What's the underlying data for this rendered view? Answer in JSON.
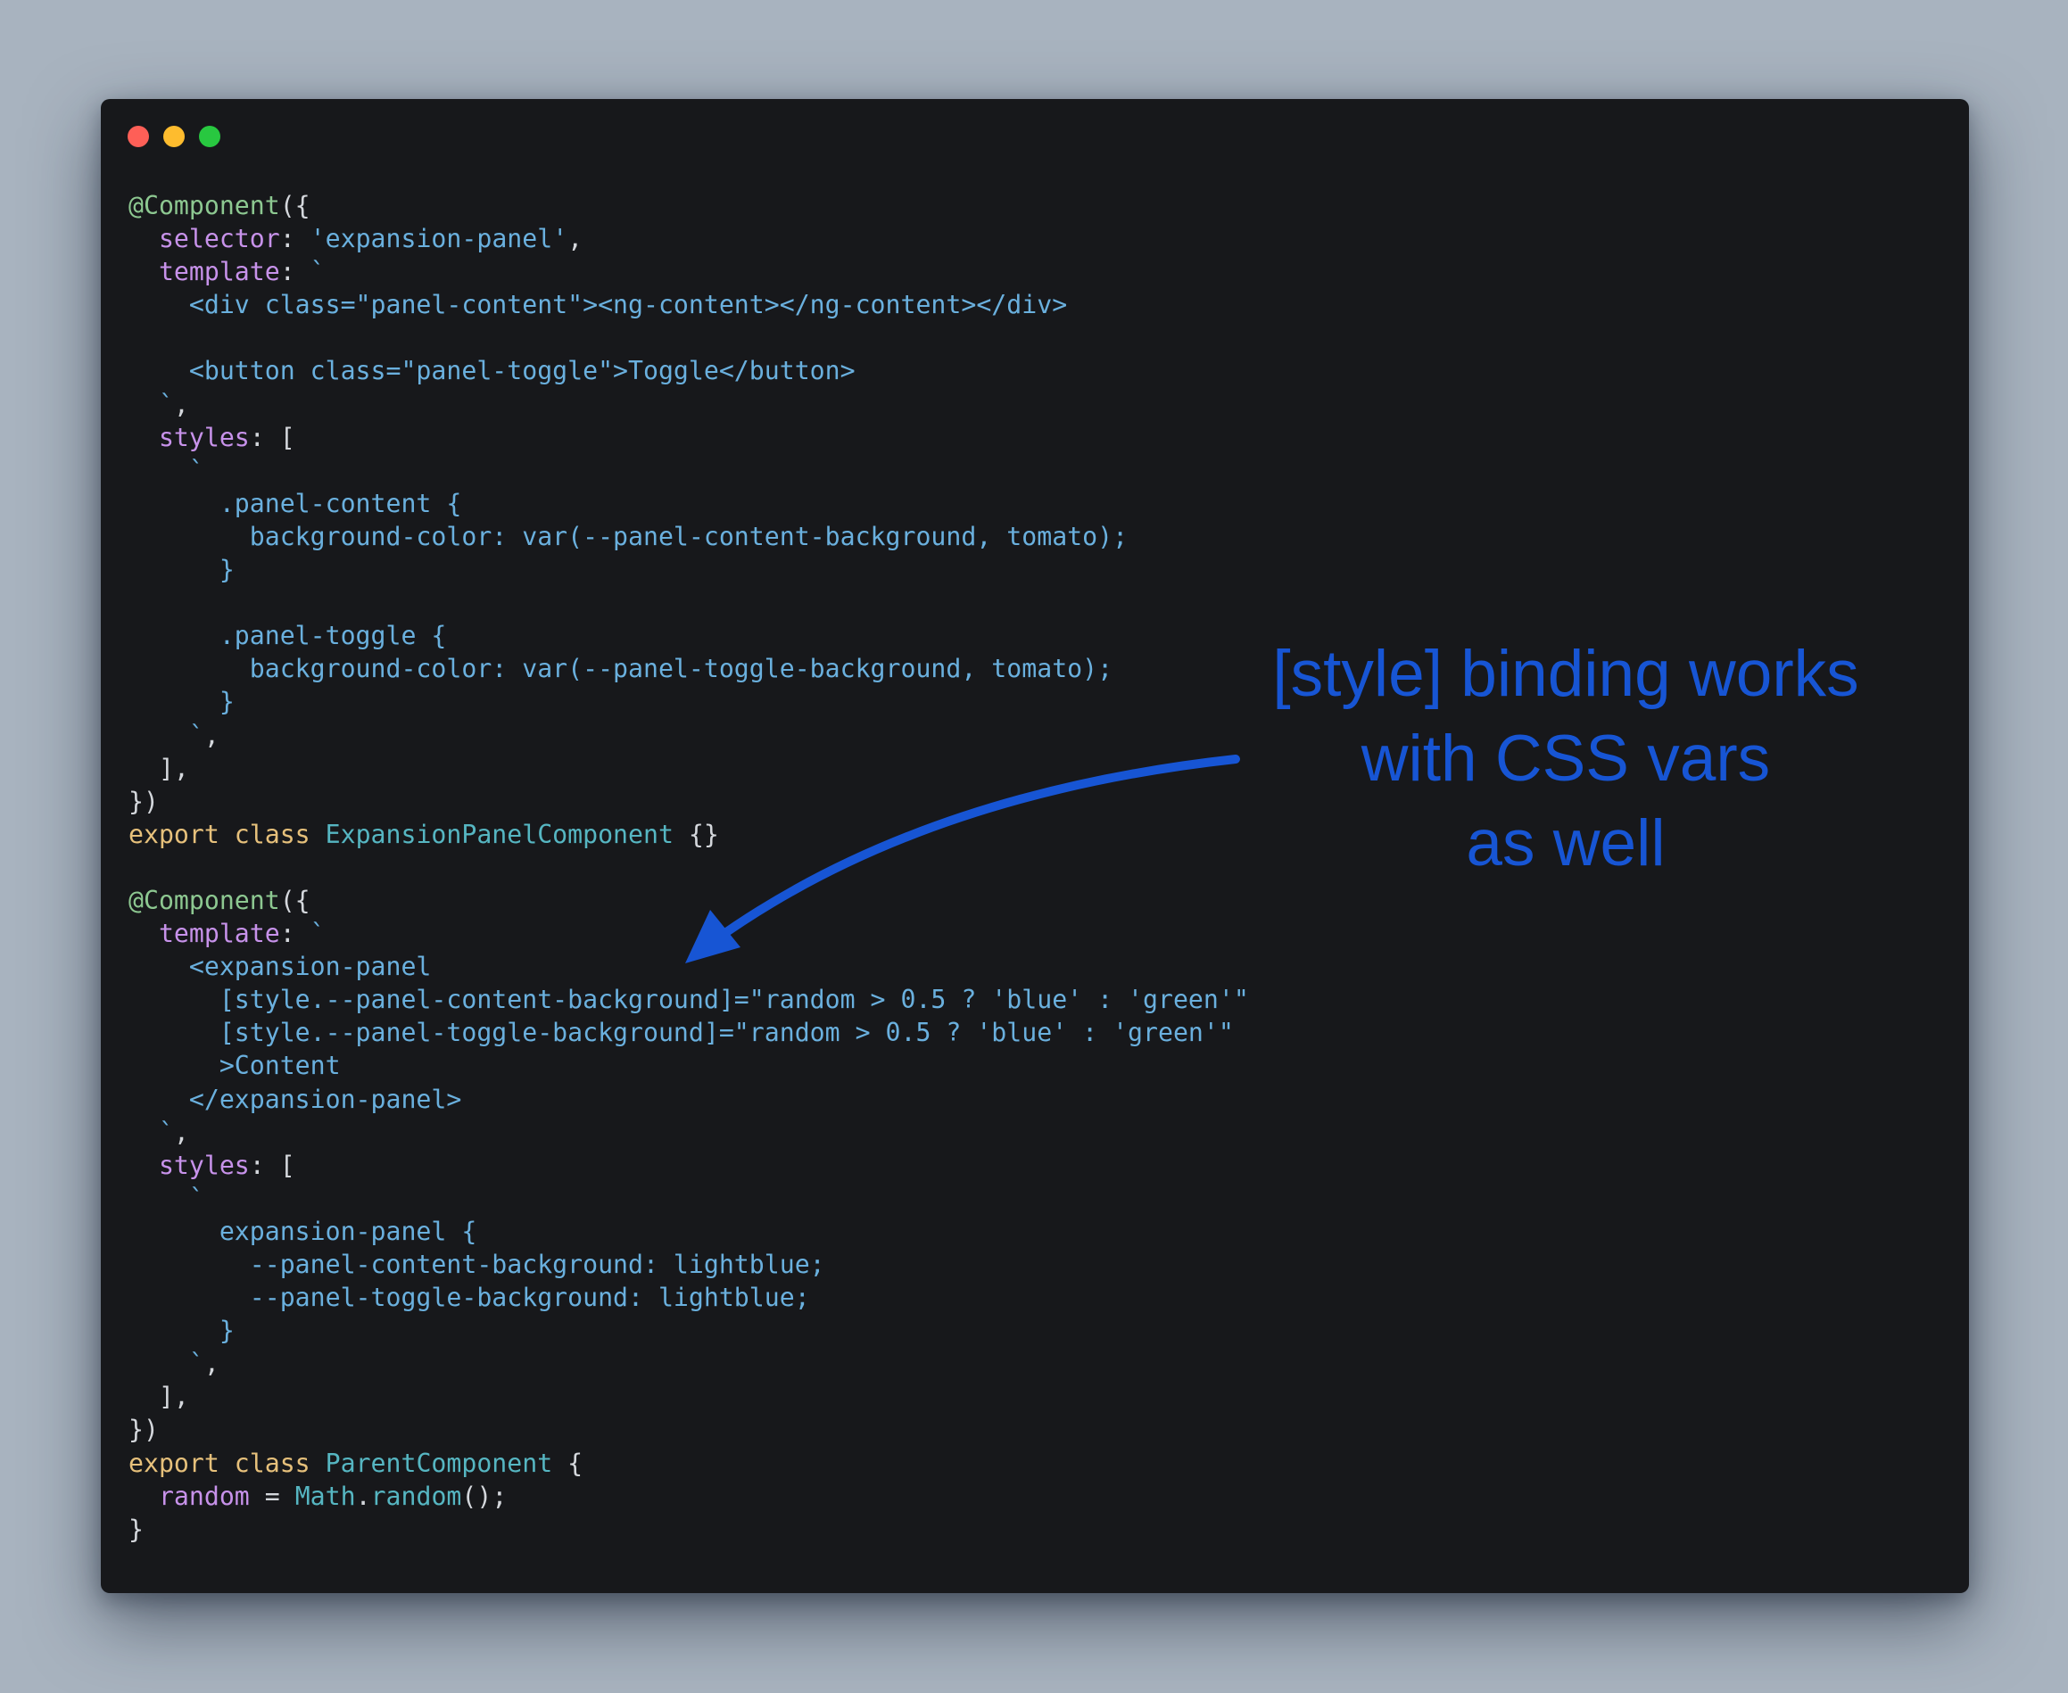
{
  "window": {
    "controls": {
      "close_color": "#fe5f57",
      "minimize_color": "#febc2e",
      "maximize_color": "#28c840"
    }
  },
  "colors": {
    "decorator": "#8dc891",
    "property": "#c792ea",
    "string": "#6ab0de",
    "keyword": "#e6c07b",
    "class_name": "#56b6c2",
    "plain": "#d4d7dc",
    "annotation": "#1755d4"
  },
  "code": {
    "lines": [
      [
        [
          "dec",
          "@Component"
        ],
        [
          "plain",
          "({"
        ]
      ],
      [
        [
          "plain",
          "  "
        ],
        [
          "prop",
          "selector"
        ],
        [
          "plain",
          ": "
        ],
        [
          "str",
          "'expansion-panel'"
        ],
        [
          "plain",
          ","
        ]
      ],
      [
        [
          "plain",
          "  "
        ],
        [
          "prop",
          "template"
        ],
        [
          "plain",
          ": "
        ],
        [
          "str",
          "`"
        ]
      ],
      [
        [
          "str",
          "    <div class=\"panel-content\"><ng-content></ng-content></div>"
        ]
      ],
      [
        [
          "str",
          ""
        ]
      ],
      [
        [
          "str",
          "    <button class=\"panel-toggle\">Toggle</button>"
        ]
      ],
      [
        [
          "str",
          "  `"
        ],
        [
          "plain",
          ","
        ]
      ],
      [
        [
          "plain",
          "  "
        ],
        [
          "prop",
          "styles"
        ],
        [
          "plain",
          ": ["
        ]
      ],
      [
        [
          "str",
          "    `"
        ]
      ],
      [
        [
          "str",
          "      .panel-content {"
        ]
      ],
      [
        [
          "str",
          "        background-color: var(--panel-content-background, tomato);"
        ]
      ],
      [
        [
          "str",
          "      }"
        ]
      ],
      [
        [
          "str",
          ""
        ]
      ],
      [
        [
          "str",
          "      .panel-toggle {"
        ]
      ],
      [
        [
          "str",
          "        background-color: var(--panel-toggle-background, tomato);"
        ]
      ],
      [
        [
          "str",
          "      }"
        ]
      ],
      [
        [
          "str",
          "    `"
        ],
        [
          "plain",
          ","
        ]
      ],
      [
        [
          "plain",
          "  ],"
        ]
      ],
      [
        [
          "plain",
          "})"
        ]
      ],
      [
        [
          "kw",
          "export class "
        ],
        [
          "class",
          "ExpansionPanelComponent"
        ],
        [
          "plain",
          " {}"
        ]
      ],
      [
        [
          "plain",
          ""
        ]
      ],
      [
        [
          "dec",
          "@Component"
        ],
        [
          "plain",
          "({"
        ]
      ],
      [
        [
          "plain",
          "  "
        ],
        [
          "prop",
          "template"
        ],
        [
          "plain",
          ": "
        ],
        [
          "str",
          "`"
        ]
      ],
      [
        [
          "str",
          "    <expansion-panel"
        ]
      ],
      [
        [
          "str",
          "      [style.--panel-content-background]=\"random > 0.5 ? 'blue' : 'green'\""
        ]
      ],
      [
        [
          "str",
          "      [style.--panel-toggle-background]=\"random > 0.5 ? 'blue' : 'green'\""
        ]
      ],
      [
        [
          "str",
          "      >Content"
        ]
      ],
      [
        [
          "str",
          "    </expansion-panel>"
        ]
      ],
      [
        [
          "str",
          "  `"
        ],
        [
          "plain",
          ","
        ]
      ],
      [
        [
          "plain",
          "  "
        ],
        [
          "prop",
          "styles"
        ],
        [
          "plain",
          ": ["
        ]
      ],
      [
        [
          "str",
          "    `"
        ]
      ],
      [
        [
          "str",
          "      expansion-panel {"
        ]
      ],
      [
        [
          "str",
          "        --panel-content-background: lightblue;"
        ]
      ],
      [
        [
          "str",
          "        --panel-toggle-background: lightblue;"
        ]
      ],
      [
        [
          "str",
          "      }"
        ]
      ],
      [
        [
          "str",
          "    `"
        ],
        [
          "plain",
          ","
        ]
      ],
      [
        [
          "plain",
          "  ],"
        ]
      ],
      [
        [
          "plain",
          "})"
        ]
      ],
      [
        [
          "kw",
          "export class "
        ],
        [
          "class",
          "ParentComponent"
        ],
        [
          "plain",
          " {"
        ]
      ],
      [
        [
          "plain",
          "  "
        ],
        [
          "prop",
          "random"
        ],
        [
          "plain",
          " = "
        ],
        [
          "fn",
          "Math"
        ],
        [
          "plain",
          "."
        ],
        [
          "fn",
          "random"
        ],
        [
          "plain",
          "();"
        ]
      ],
      [
        [
          "plain",
          "}"
        ]
      ]
    ]
  },
  "annotation": {
    "line1": "[style] binding works",
    "line2": "with CSS vars",
    "line3": "as well"
  }
}
